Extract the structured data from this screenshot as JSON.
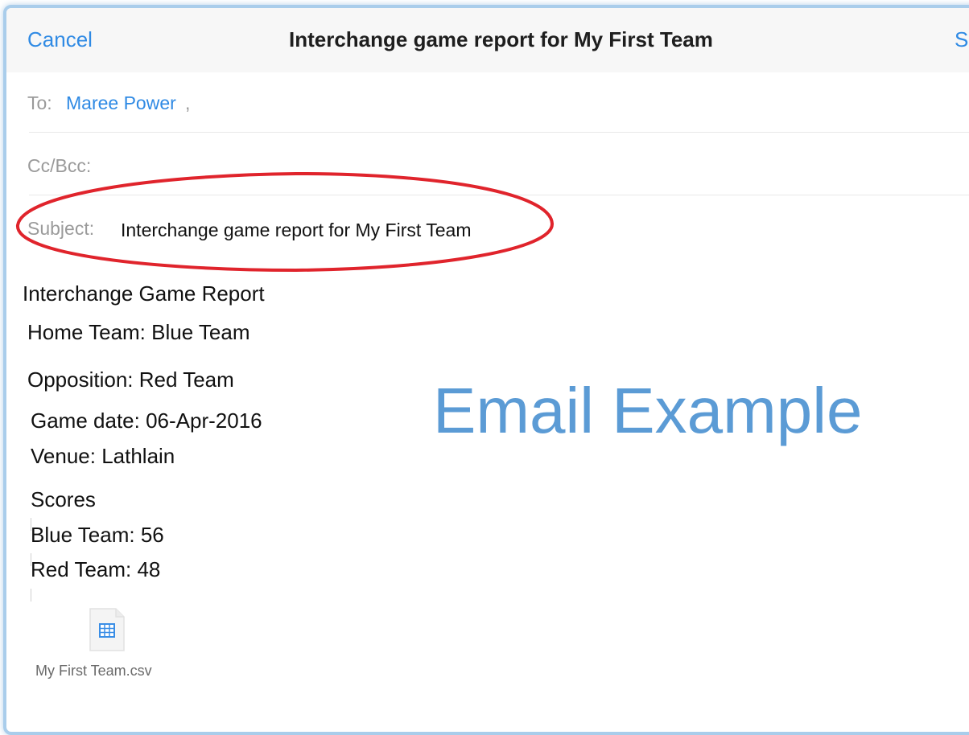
{
  "navbar": {
    "cancel_label": "Cancel",
    "title": "Interchange game report for My First Team",
    "send_label_partial": "Se"
  },
  "header_fields": {
    "to_label": "To:",
    "to_recipient": "Maree Power",
    "to_separator": ",",
    "cc_bcc_label": "Cc/Bcc:",
    "subject_label": "Subject:",
    "subject_value": "Interchange game report for My First Team"
  },
  "body": {
    "lines": [
      "Interchange Game Report",
      "Home Team: Blue Team",
      "Opposition: Red Team",
      "Game date: 06-Apr-2016",
      "Venue: Lathlain",
      "Scores",
      "Blue Team: 56",
      "Red Team: 48"
    ]
  },
  "attachment": {
    "file_name": "My First Team.csv",
    "icon": "spreadsheet-file-icon"
  },
  "overlay": {
    "caption": "Email Example"
  },
  "colors": {
    "accent_blue": "#2f8ae4",
    "highlight_red": "#e0242c",
    "caption_blue": "#5b9bd5",
    "frame_border": "#a9cdeb"
  }
}
